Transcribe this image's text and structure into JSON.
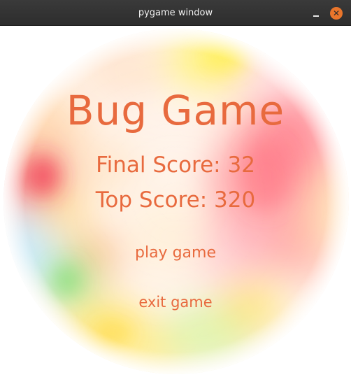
{
  "window": {
    "title": "pygame window",
    "minimize_icon": "minimize-icon",
    "close_icon": "close-icon",
    "close_color": "#e9752b"
  },
  "game": {
    "title": "Bug Game",
    "final_score": "Final Score: 32",
    "top_score": "Top Score: 320",
    "play_label": "play game",
    "exit_label": "exit game",
    "text_color": "#e86a3e"
  }
}
